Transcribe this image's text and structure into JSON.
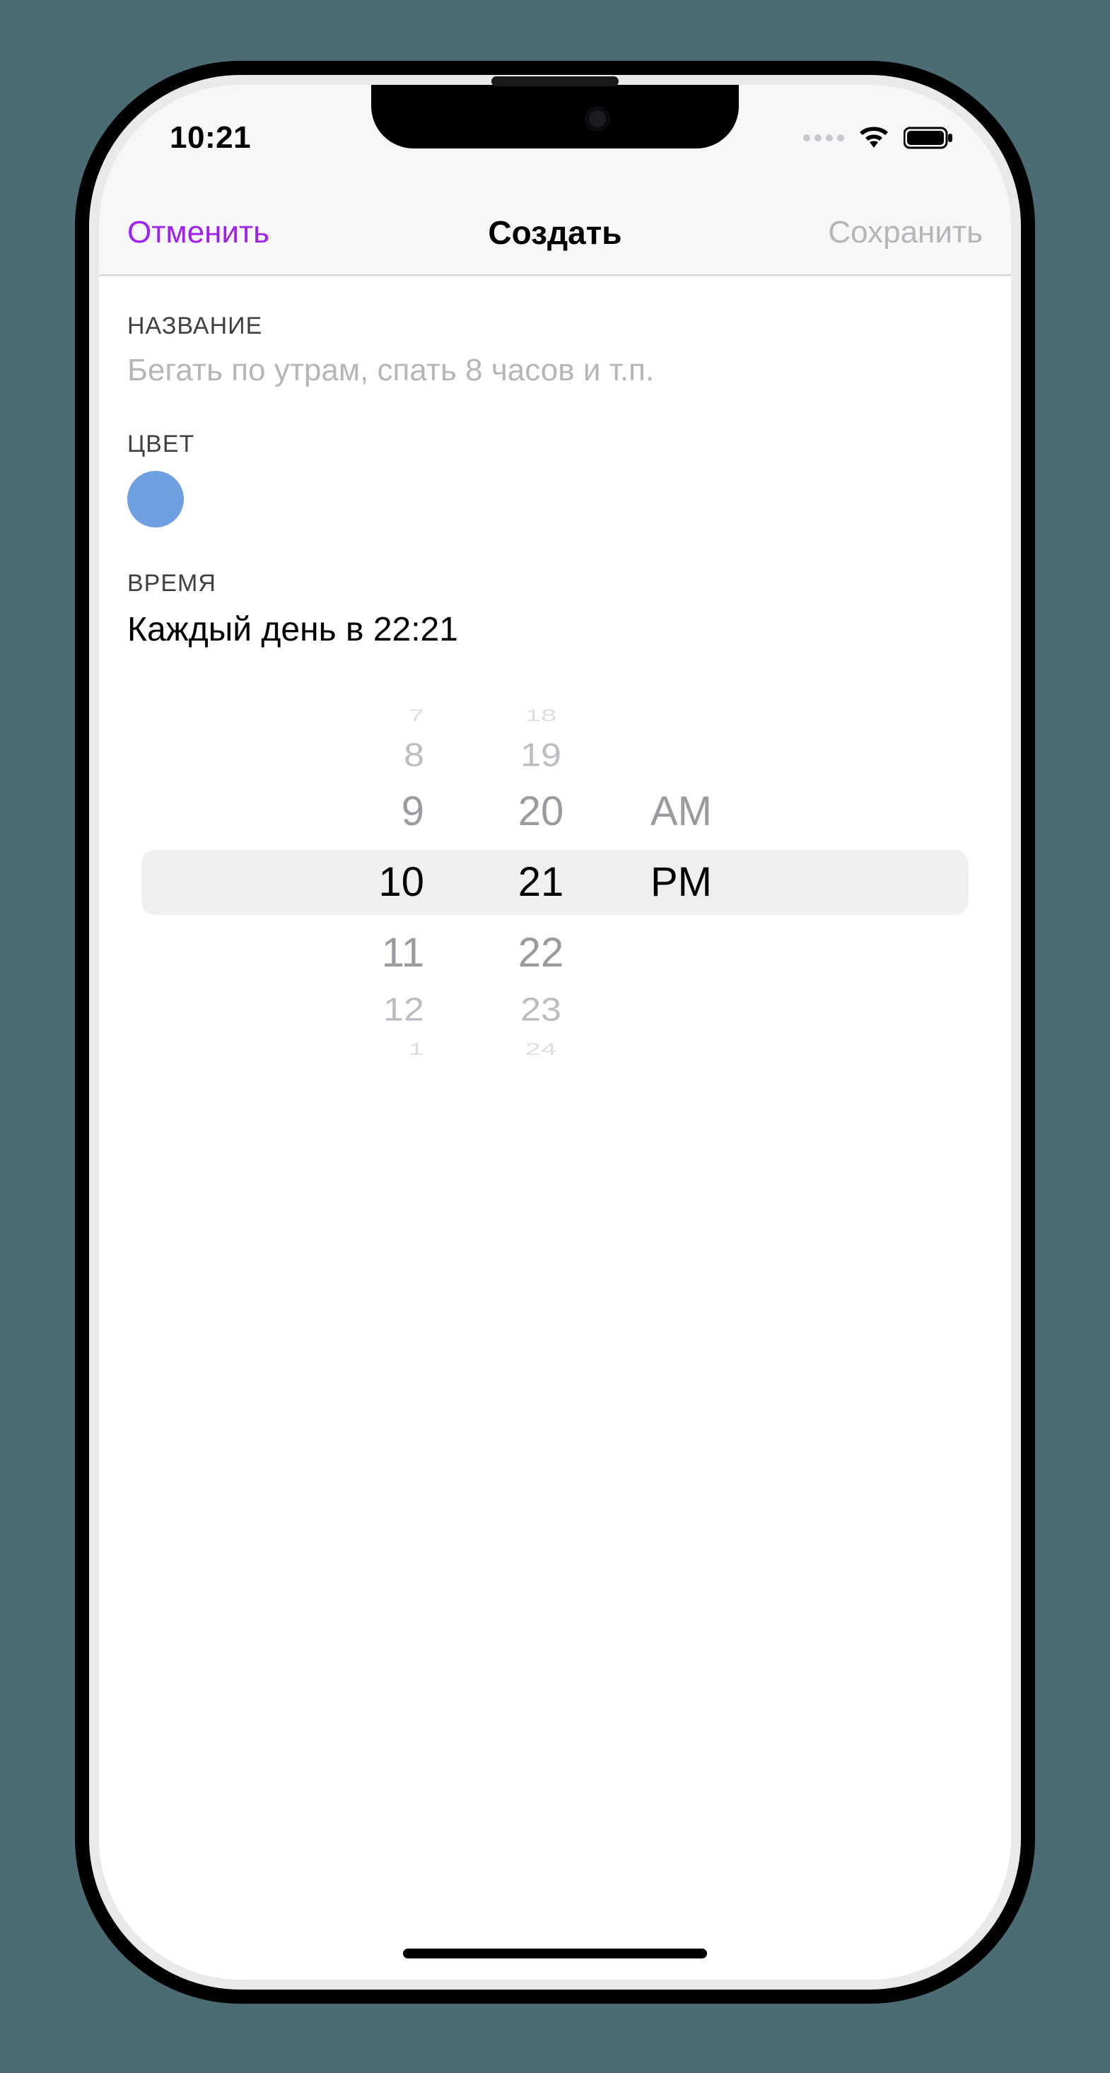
{
  "statusbar": {
    "time": "10:21"
  },
  "nav": {
    "cancel": "Отменить",
    "title": "Создать",
    "save": "Сохранить"
  },
  "sections": {
    "name": {
      "label": "НАЗВАНИЕ",
      "placeholder": "Бегать по утрам, спать 8 часов и т.п.",
      "value": ""
    },
    "color": {
      "label": "ЦВЕТ",
      "hex": "#6e9fe0"
    },
    "time": {
      "label": "ВРЕМЯ",
      "summary": "Каждый день в 22:21"
    }
  },
  "picker": {
    "hours": {
      "n3up": "7",
      "n2up": "8",
      "n1up": "9",
      "sel": "10",
      "n1dn": "11",
      "n2dn": "12",
      "n3dn": "1"
    },
    "minutes": {
      "n3up": "18",
      "n2up": "19",
      "n1up": "20",
      "sel": "21",
      "n1dn": "22",
      "n2dn": "23",
      "n3dn": "24"
    },
    "ampm": {
      "n1up": "AM",
      "sel": "PM"
    }
  }
}
